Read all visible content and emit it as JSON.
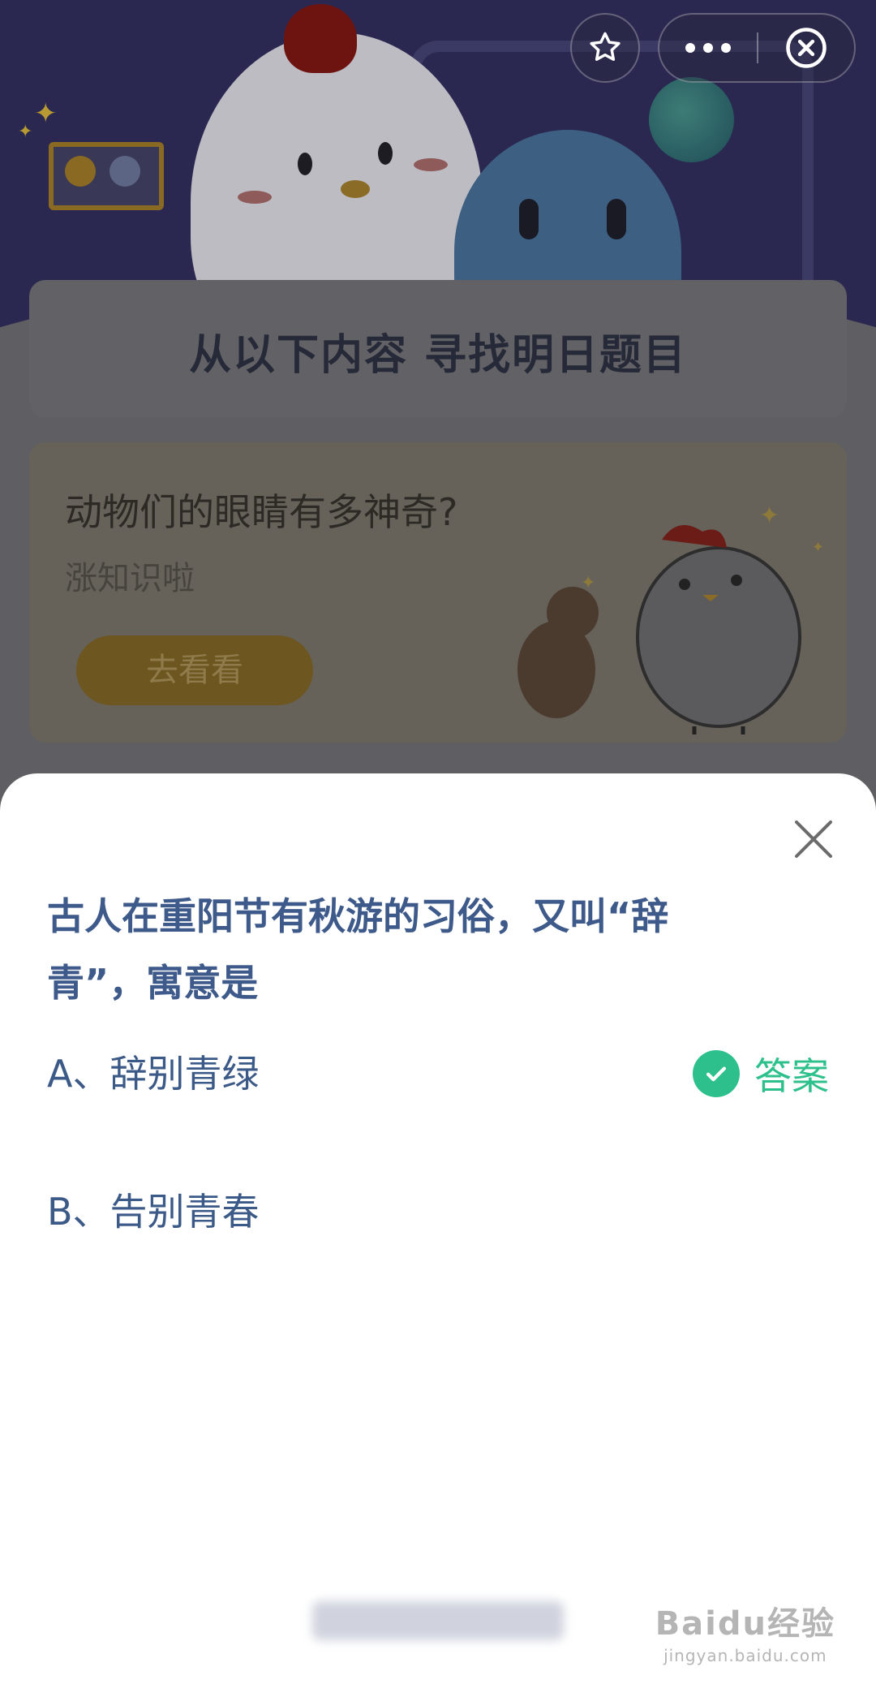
{
  "background": {
    "title_banner": "从以下内容  寻找明日题目",
    "promo": {
      "title": "动物们的眼睛有多神奇?",
      "subtitle": "涨知识啦",
      "button_label": "去看看"
    }
  },
  "top_bar": {
    "favorite_icon": "star-outline-icon",
    "more_icon": "more-dots-icon",
    "close_icon": "close-circle-icon"
  },
  "sheet": {
    "question": "古人在重阳节有秋游的习俗，又叫“辞青”，寓意是",
    "options": [
      {
        "label": "A、辞别青绿",
        "is_answer": true
      },
      {
        "label": "B、告别青春",
        "is_answer": false
      }
    ],
    "answer_label": "答案",
    "answer_color": "#2ec08c",
    "question_color": "#3d5a8a"
  },
  "watermark": {
    "brand": "Baidu经验",
    "url": "jingyan.baidu.com"
  }
}
